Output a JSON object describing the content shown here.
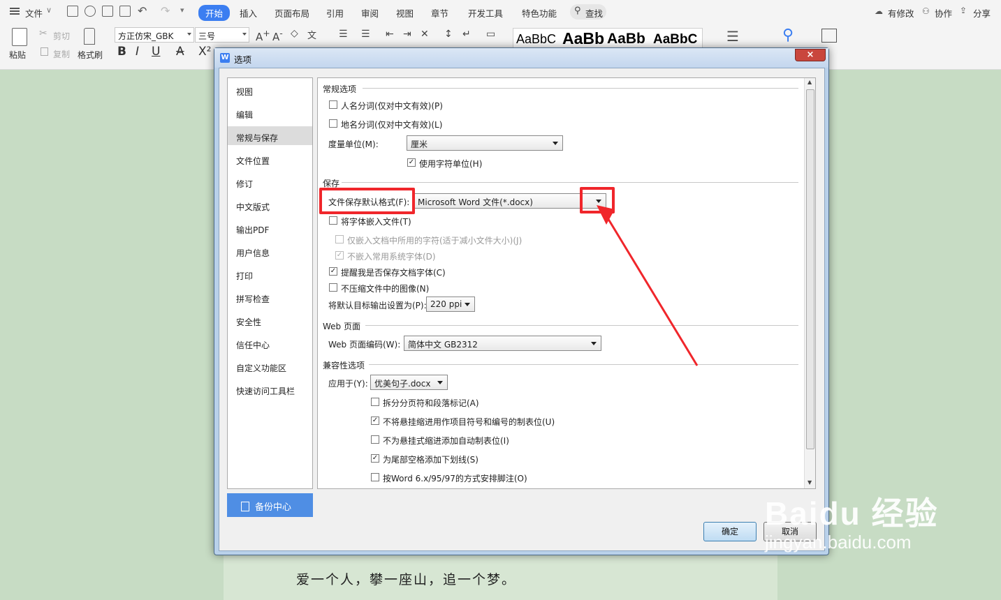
{
  "menubar": {
    "file": "文件",
    "tabs": [
      "开始",
      "插入",
      "页面布局",
      "引用",
      "审阅",
      "视图",
      "章节",
      "开发工具",
      "特色功能"
    ],
    "active_tab": "开始",
    "search": "查找",
    "right": {
      "modified": "有修改",
      "collab": "协作",
      "share": "分享"
    }
  },
  "ribbon": {
    "paste": "粘贴",
    "cut": "剪切",
    "copy": "复制",
    "format_painter": "格式刷",
    "font_name": "方正仿宋_GBK",
    "font_size": "三号",
    "styles": [
      "AaBbC",
      "AaBb",
      "AaBb",
      "AaBbC"
    ]
  },
  "document": {
    "text": "爱一个人，攀一座山，追一个梦。"
  },
  "dialog": {
    "title": "选项",
    "close": "×",
    "nav": [
      "视图",
      "编辑",
      "常规与保存",
      "文件位置",
      "修订",
      "中文版式",
      "输出PDF",
      "用户信息",
      "打印",
      "拼写检查",
      "安全性",
      "信任中心",
      "自定义功能区",
      "快速访问工具栏"
    ],
    "nav_selected": "常规与保存",
    "backup": "备份中心",
    "general": {
      "title": "常规选项",
      "person_seg": "人名分词(仅对中文有效)(P)",
      "place_seg": "地名分词(仅对中文有效)(L)",
      "unit_label": "度量单位(M):",
      "unit_value": "厘米",
      "char_unit": "使用字符单位(H)"
    },
    "save": {
      "title": "保存",
      "format_label": "文件保存默认格式(F):",
      "format_value": "Microsoft Word 文件(*.docx)",
      "embed": "将字体嵌入文件(T)",
      "embed_used": "仅嵌入文档中所用的字符(适于减小文件大小)(J)",
      "no_common": "不嵌入常用系统字体(D)",
      "remind": "提醒我是否保存文档字体(C)",
      "no_compress": "不压缩文件中的图像(N)",
      "ppi_label": "将默认目标输出设置为(P):",
      "ppi_value": "220 ppi"
    },
    "web": {
      "title": "Web 页面",
      "encoding_label": "Web 页面编码(W):",
      "encoding_value": "简体中文 GB2312"
    },
    "compat": {
      "title": "兼容性选项",
      "apply_label": "应用于(Y):",
      "apply_value": "优美句子.docx",
      "opt1": "拆分分页符和段落标记(A)",
      "opt2": "不将悬挂缩进用作项目符号和编号的制表位(U)",
      "opt3": "不为悬挂式缩进添加自动制表位(I)",
      "opt4": "为尾部空格添加下划线(S)",
      "opt5": "按Word 6.x/95/97的方式安排脚注(O)"
    },
    "ok": "确定",
    "cancel": "取消"
  },
  "watermark": {
    "brand": "Baidu 经验",
    "url": "jingyan.baidu.com"
  },
  "colors": {
    "accent": "#3b7ef1",
    "highlight": "#f0262b",
    "page_bg": "#c7dcc4"
  }
}
